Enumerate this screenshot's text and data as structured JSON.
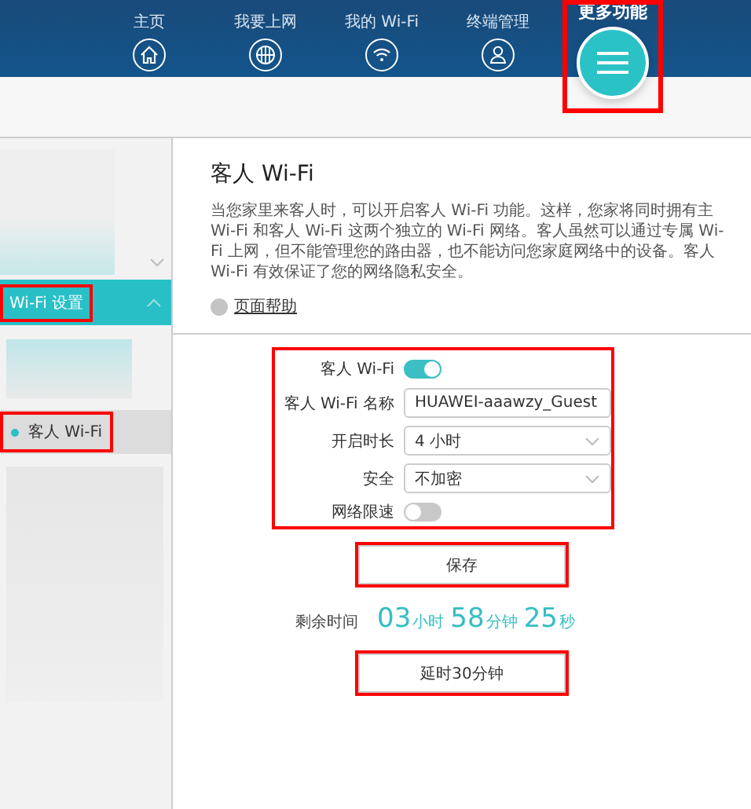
{
  "nav": [
    {
      "label": "主页",
      "selected": false,
      "highlighted": false
    },
    {
      "label": "我要上网",
      "selected": false,
      "highlighted": false
    },
    {
      "label": "我的 Wi-Fi",
      "selected": false,
      "highlighted": false
    },
    {
      "label": "终端管理",
      "selected": false,
      "highlighted": false
    },
    {
      "label": "更多功能",
      "selected": true,
      "highlighted": true
    }
  ],
  "sidebar": [
    {
      "kind": "blurred-group",
      "expanded": false
    },
    {
      "kind": "group",
      "label": "Wi-Fi 设置",
      "expanded": true,
      "highlighted": true
    },
    {
      "kind": "blurred-item"
    },
    {
      "kind": "item",
      "label": "客人 Wi-Fi",
      "selected": true,
      "highlighted": true
    },
    {
      "kind": "blurred-item"
    }
  ],
  "content": {
    "title": "客人 Wi-Fi",
    "description": "当您家里来客人时，可以开启客人 Wi-Fi 功能。这样，您家将同时拥有主 Wi-Fi 和客人 Wi-Fi 这两个独立的 Wi-Fi 网络。客人虽然可以通过专属 Wi-Fi 上网，但不能管理您的路由器，也不能访问您家庭网络中的设备。客人 Wi-Fi 有效保证了您的网络隐私安全。",
    "help_link": "页面帮助",
    "form": {
      "highlighted": true,
      "fields": [
        {
          "kind": "toggle",
          "label": "客人 Wi-Fi",
          "on": true
        },
        {
          "kind": "text",
          "label": "客人 Wi-Fi 名称",
          "value": "HUAWEI-aaawzy_Guest"
        },
        {
          "kind": "select",
          "label": "开启时长",
          "value": "4 小时"
        },
        {
          "kind": "select",
          "label": "安全",
          "value": "不加密"
        },
        {
          "kind": "toggle",
          "label": "网络限速",
          "on": false
        }
      ]
    },
    "save_button": {
      "label": "保存",
      "highlighted": true
    },
    "remaining": {
      "label": "剩余时间",
      "parts": [
        {
          "value": "03",
          "unit": "小时"
        },
        {
          "value": "58",
          "unit": "分钟"
        },
        {
          "value": "25",
          "unit": "秒"
        }
      ]
    },
    "extend_button": {
      "label": "延时30分钟",
      "highlighted": true
    }
  }
}
